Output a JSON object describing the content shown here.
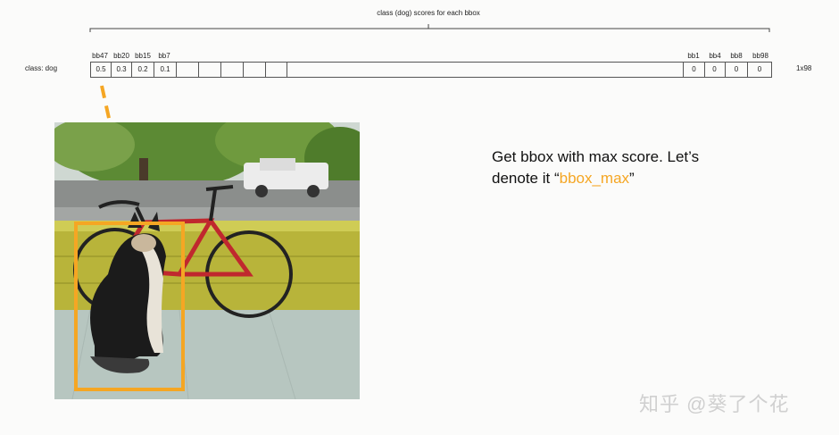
{
  "header": {
    "brace_label": "class (dog) scores for each bbox",
    "row_label": "class: dog",
    "dimensions": "1x98"
  },
  "columns_left": [
    {
      "label": "bb47",
      "value": "0.5"
    },
    {
      "label": "bb20",
      "value": "0.3"
    },
    {
      "label": "bb15",
      "value": "0.2"
    },
    {
      "label": "bb7",
      "value": "0.1"
    }
  ],
  "columns_right": [
    {
      "label": "bb1",
      "value": "0"
    },
    {
      "label": "bb4",
      "value": "0"
    },
    {
      "label": "bb8",
      "value": "0"
    },
    {
      "label": "bb98",
      "value": "0"
    }
  ],
  "callout": {
    "line1": "Get bbox with max score. Let’s",
    "line2_prefix": "denote it “",
    "line2_highlight": "bbox_max",
    "line2_suffix": "”"
  },
  "watermark": "知乎 @葵了个花",
  "colors": {
    "highlight": "#f5a623",
    "bbox": "#f5a623",
    "grid": "#555555"
  }
}
